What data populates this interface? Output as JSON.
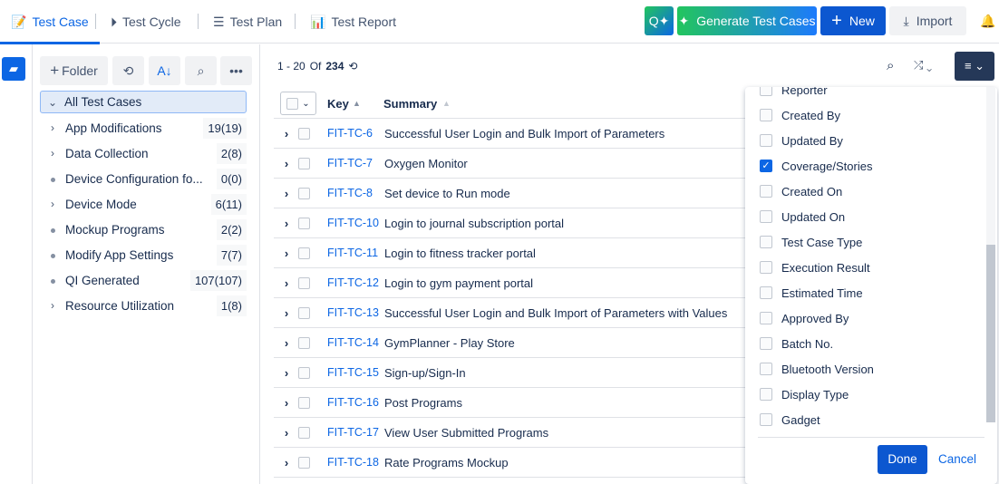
{
  "nav": {
    "tabs": [
      {
        "label": "Test Case",
        "icon": "edit-doc-icon"
      },
      {
        "label": "Test Cycle",
        "icon": "play-cycle-icon"
      },
      {
        "label": "Test Plan",
        "icon": "list-doc-icon"
      },
      {
        "label": "Test Report",
        "icon": "bar-chart-icon"
      }
    ],
    "generate": "Generate Test Cases",
    "new": "New",
    "import": "Import"
  },
  "tree": {
    "folder_btn": "Folder",
    "root": "All Test Cases",
    "items": [
      {
        "label": "App Modifications",
        "count": "19(19)",
        "expand": true
      },
      {
        "label": "Data Collection",
        "count": "2(8)",
        "expand": true
      },
      {
        "label": "Device Configuration fo...",
        "count": "0(0)",
        "expand": false
      },
      {
        "label": "Device Mode",
        "count": "6(11)",
        "expand": true
      },
      {
        "label": "Mockup Programs",
        "count": "2(2)",
        "expand": false
      },
      {
        "label": "Modify App Settings",
        "count": "7(7)",
        "expand": false
      },
      {
        "label": "QI Generated",
        "count": "107(107)",
        "expand": false
      },
      {
        "label": "Resource Utilization",
        "count": "1(8)",
        "expand": true
      }
    ]
  },
  "pager": {
    "range": "1 - 20",
    "of": "Of",
    "total": "234"
  },
  "table": {
    "headers": {
      "key": "Key",
      "summary": "Summary"
    },
    "rows": [
      {
        "key": "FIT-TC-6",
        "summary": "Successful User Login and Bulk Import of Parameters"
      },
      {
        "key": "FIT-TC-7",
        "summary": "Oxygen Monitor"
      },
      {
        "key": "FIT-TC-8",
        "summary": "Set device to Run mode"
      },
      {
        "key": "FIT-TC-10",
        "summary": "Login to journal subscription portal"
      },
      {
        "key": "FIT-TC-11",
        "summary": "Login to fitness tracker portal"
      },
      {
        "key": "FIT-TC-12",
        "summary": "Login to gym payment portal"
      },
      {
        "key": "FIT-TC-13",
        "summary": "Successful User Login and Bulk Import of Parameters with Values"
      },
      {
        "key": "FIT-TC-14",
        "summary": "GymPlanner - Play Store"
      },
      {
        "key": "FIT-TC-15",
        "summary": "Sign-up/Sign-In"
      },
      {
        "key": "FIT-TC-16",
        "summary": "Post Programs"
      },
      {
        "key": "FIT-TC-17",
        "summary": "View User Submitted Programs"
      },
      {
        "key": "FIT-TC-18",
        "summary": "Rate Programs Mockup"
      }
    ]
  },
  "columns": {
    "options": [
      {
        "label": "Reporter",
        "checked": false
      },
      {
        "label": "Created By",
        "checked": false
      },
      {
        "label": "Updated By",
        "checked": false
      },
      {
        "label": "Coverage/Stories",
        "checked": true
      },
      {
        "label": "Created On",
        "checked": false
      },
      {
        "label": "Updated On",
        "checked": false
      },
      {
        "label": "Test Case Type",
        "checked": false
      },
      {
        "label": "Execution Result",
        "checked": false
      },
      {
        "label": "Estimated Time",
        "checked": false
      },
      {
        "label": "Approved By",
        "checked": false
      },
      {
        "label": "Batch No.",
        "checked": false
      },
      {
        "label": "Bluetooth Version",
        "checked": false
      },
      {
        "label": "Display Type",
        "checked": false
      },
      {
        "label": "Gadget",
        "checked": false
      }
    ],
    "done": "Done",
    "cancel": "Cancel"
  },
  "colors": {
    "accent": "#0c66e4",
    "dark": "#253858"
  }
}
